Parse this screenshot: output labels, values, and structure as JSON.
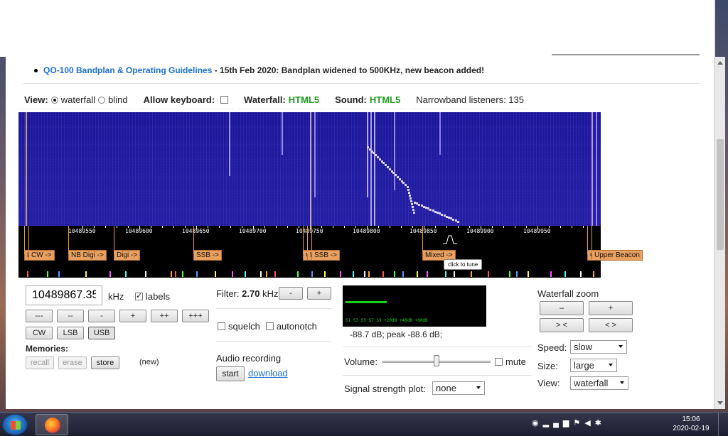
{
  "news": {
    "link_text": "QO-100 Bandplan & Operating Guidelines",
    "text": " - 15th Feb 2020: Bandplan widened to 500KHz, new beacon added!"
  },
  "viewbar": {
    "view_label": "View:",
    "opt_waterfall": "waterfall",
    "opt_blind": "blind",
    "allow_keyboard": "Allow keyboard:",
    "waterfall_label": "Waterfall:",
    "waterfall_value": "HTML5",
    "sound_label": "Sound:",
    "sound_value": "HTML5",
    "listeners": "Narrowband listeners: 135"
  },
  "scale": {
    "ticks": [
      "10489550",
      "10489600",
      "10489650",
      "10489700",
      "10489750",
      "10489800",
      "10489850",
      "10489900",
      "10489950"
    ],
    "bands": [
      "L",
      "CW ->",
      "NB Digi ->",
      "Digi ->",
      "SSB ->",
      "C",
      "N",
      "SSB ->",
      "Mixed ->",
      "C",
      "Upper Beacon"
    ],
    "tooltip": "click to tune"
  },
  "freq": {
    "value": "10489867.35",
    "unit": "kHz",
    "labels": "labels",
    "step_buttons": [
      "---",
      "--",
      "-",
      "+",
      "++",
      "+++"
    ],
    "modes": [
      "CW",
      "LSB",
      "USB"
    ],
    "memories": "Memories:",
    "mem_buttons": [
      "recall",
      "erase",
      "store"
    ],
    "new": "(new)"
  },
  "filter": {
    "label": "Filter:",
    "value": "2.70",
    "unit": "kHz",
    "minus": "-",
    "plus": "+",
    "squelch": "squelch",
    "autonotch": "autonotch",
    "audio_title": "Audio recording",
    "start": "start",
    "download": "download"
  },
  "smeter": {
    "level_fraction": 0.3,
    "scale": "S1    S3    S5    S7    S9    +20dB  +40dB  +60dB",
    "reading": "-88.7 dB; peak  -88.6 dB;",
    "volume": "Volume:",
    "volume_fraction": 0.5,
    "mute": "mute",
    "ssp_label": "Signal strength plot:",
    "ssp_value": "none"
  },
  "zoom": {
    "title": "Waterfall zoom",
    "buttons": [
      "–",
      "+",
      "> <",
      "< >"
    ],
    "speed_label": "Speed:",
    "speed_value": "slow",
    "size_label": "Size:",
    "size_value": "large",
    "view_label": "View:",
    "view_value": "waterfall"
  },
  "taskbar": {
    "time": "15:06",
    "date": "2020-02-19"
  },
  "colors": {
    "link": "#1a6fd0",
    "green": "#1a9a1a",
    "waterfall_bg": "#1f1a9c",
    "band_orange": "#e8a060"
  }
}
